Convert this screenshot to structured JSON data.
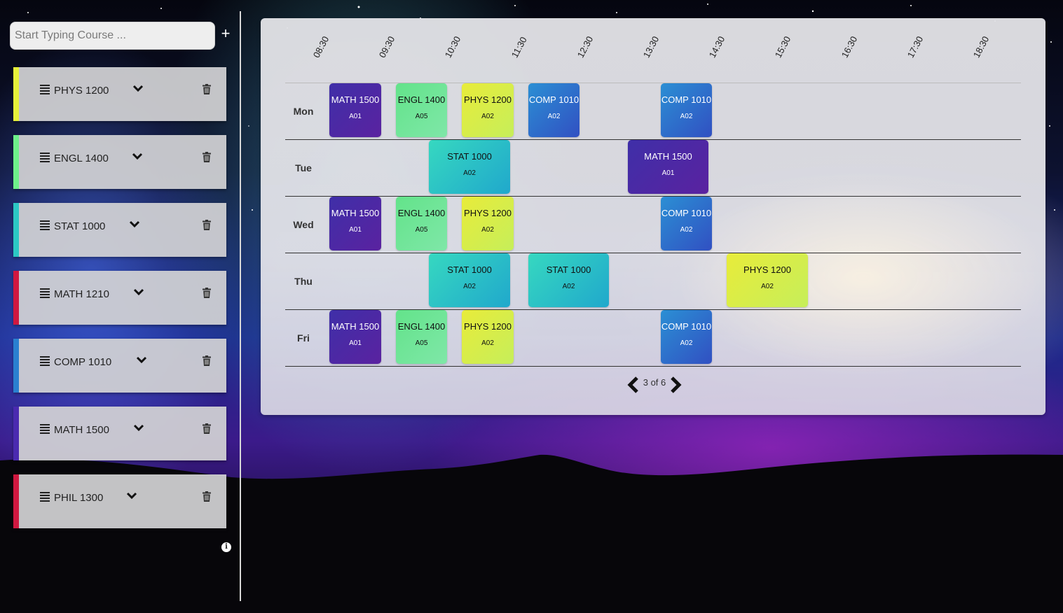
{
  "search": {
    "placeholder": "Start Typing Course ..."
  },
  "add_label": "+",
  "courses": [
    {
      "name": "PHYS 1200",
      "color": "#e6f03a"
    },
    {
      "name": "ENGL 1400",
      "color": "#6ef08a"
    },
    {
      "name": "STAT 1000",
      "color": "#2cc8c4"
    },
    {
      "name": "MATH 1210",
      "color": "#d01840"
    },
    {
      "name": "COMP 1010",
      "color": "#2a80d0"
    },
    {
      "name": "MATH 1500",
      "color": "#4a2ab0"
    },
    {
      "name": "PHIL 1300",
      "color": "#d01840"
    }
  ],
  "info_icon": "i",
  "schedule": {
    "times": [
      "08:30",
      "09:30",
      "10:30",
      "11:30",
      "12:30",
      "13:30",
      "14:30",
      "15:30",
      "16:30",
      "17:30",
      "18:30"
    ],
    "days": [
      "Mon",
      "Tue",
      "Wed",
      "Thu",
      "Fri"
    ],
    "blocks": {
      "mon_math": {
        "course": "MATH 1500",
        "section": "A01"
      },
      "mon_engl": {
        "course": "ENGL 1400",
        "section": "A05"
      },
      "mon_phys": {
        "course": "PHYS 1200",
        "section": "A02"
      },
      "mon_comp1": {
        "course": "COMP 1010",
        "section": "A02"
      },
      "mon_comp2": {
        "course": "COMP 1010",
        "section": "A02"
      },
      "tue_stat": {
        "course": "STAT 1000",
        "section": "A02"
      },
      "tue_math": {
        "course": "MATH 1500",
        "section": "A01"
      },
      "wed_math": {
        "course": "MATH 1500",
        "section": "A01"
      },
      "wed_engl": {
        "course": "ENGL 1400",
        "section": "A05"
      },
      "wed_phys": {
        "course": "PHYS 1200",
        "section": "A02"
      },
      "wed_comp": {
        "course": "COMP 1010",
        "section": "A02"
      },
      "thu_stat1": {
        "course": "STAT 1000",
        "section": "A02"
      },
      "thu_stat2": {
        "course": "STAT 1000",
        "section": "A02"
      },
      "thu_phys": {
        "course": "PHYS 1200",
        "section": "A02"
      },
      "fri_math": {
        "course": "MATH 1500",
        "section": "A01"
      },
      "fri_engl": {
        "course": "ENGL 1400",
        "section": "A05"
      },
      "fri_phys": {
        "course": "PHYS 1200",
        "section": "A02"
      },
      "fri_comp": {
        "course": "COMP 1010",
        "section": "A02"
      }
    },
    "pager": {
      "text": "3 of 6"
    }
  }
}
